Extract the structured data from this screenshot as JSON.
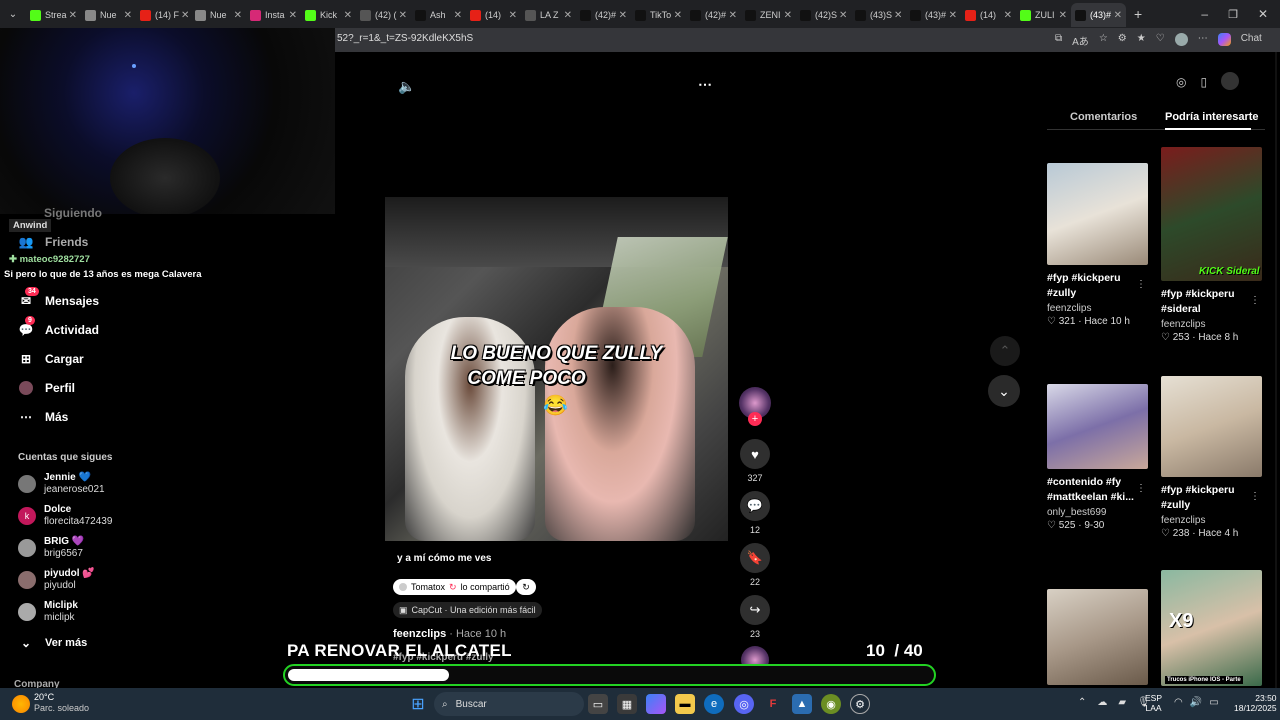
{
  "tabs": [
    {
      "label": "Strea",
      "color": "#53fc18"
    },
    {
      "label": "Nue",
      "color": "#888"
    },
    {
      "label": "(14) F",
      "color": "#e62117"
    },
    {
      "label": "Nue",
      "color": "#888"
    },
    {
      "label": "Insta",
      "color": "#d62976"
    },
    {
      "label": "Kick",
      "color": "#53fc18"
    },
    {
      "label": "(42) (",
      "color": "#555"
    },
    {
      "label": "Ash",
      "color": "#111"
    },
    {
      "label": "(14)",
      "color": "#e62117"
    },
    {
      "label": "LA Z",
      "color": "#555"
    },
    {
      "label": "(42)#",
      "color": "#111"
    },
    {
      "label": "TikTo",
      "color": "#111"
    },
    {
      "label": "(42)#",
      "color": "#111"
    },
    {
      "label": "ZENI",
      "color": "#111"
    },
    {
      "label": "(42)S",
      "color": "#111"
    },
    {
      "label": "(43)S",
      "color": "#111"
    },
    {
      "label": "(43)#",
      "color": "#111"
    },
    {
      "label": "(14)",
      "color": "#e62117"
    },
    {
      "label": "ZULI",
      "color": "#53fc18"
    },
    {
      "label": "(43)#",
      "color": "#111",
      "active": true
    }
  ],
  "url": "52?_r=1&_t=ZS-92KdleKX5hS",
  "browser": {
    "chat_label": "Chat"
  },
  "overlay": {
    "chat_user1": "Anwind",
    "chat_user2": "mateoc9282727",
    "chat_message": "Si pero lo que de 13 años es mega Calavera",
    "faded_nav": "Siguiendo"
  },
  "nav": {
    "friends": "Friends",
    "messages": "Mensajes",
    "messages_badge": "34",
    "activity": "Actividad",
    "activity_badge": "9",
    "upload": "Cargar",
    "profile": "Perfil",
    "more": "Más",
    "following_header": "Cuentas que sigues",
    "see_more": "Ver más",
    "company": "Company"
  },
  "following": [
    {
      "name": "Jennie 💙",
      "handle": "jeanerose021",
      "color": "#777"
    },
    {
      "name": "Dolce",
      "handle": "florecita472439",
      "color": "#c2185b",
      "initial": "k"
    },
    {
      "name": "BRIG 💜",
      "handle": "brig6567",
      "color": "#999"
    },
    {
      "name": "piyudol 💕",
      "handle": "piyudol",
      "color": "#8a6d6d"
    },
    {
      "name": "Miclipk",
      "handle": "miclipk",
      "color": "#aaa"
    }
  ],
  "video": {
    "caption_line1": "LO BUENO QUE ZULLY",
    "caption_line2": "COME POCO",
    "emoji": "😂",
    "description": "y a mí cómo me ves",
    "shared_by": "Tomatox",
    "shared_text": "lo compartió",
    "capcut": "CapCut · Una edición más fácil",
    "author": "feenzclips",
    "time": "· Hace 10 h",
    "tags": "#fyp #kickperu #zully"
  },
  "actions": {
    "likes": "327",
    "comments": "12",
    "saves": "22",
    "shares": "23"
  },
  "panel": {
    "tab_comments": "Comentarios",
    "tab_interesting": "Podría interesarte"
  },
  "cards": [
    {
      "title": "#fyp #kickperu #zully",
      "author": "feenzclips",
      "meta": "♡ 321 · Hace 10 h",
      "bg": "linear-gradient(160deg,#b8c9d6,#e8e2d8 50%,#9a8a78)"
    },
    {
      "title": "#fyp #kickperu #sideral",
      "author": "feenzclips",
      "meta": "♡ 253 · Hace 8 h",
      "bg": "linear-gradient(160deg,#7a1c1c,#2d4a2a 50%,#3a2a1a)"
    },
    {
      "title": "#contenido #fy #mattkeelan #ki...",
      "author": "only_best699",
      "meta": "♡ 525 · 9-30",
      "bg": "linear-gradient(160deg,#d9d9e8,#7c6fa8 50%,#c9a89a)"
    },
    {
      "title": "#fyp #kickperu #zully",
      "author": "feenzclips",
      "meta": "♡ 238 · Hace 4 h",
      "bg": "linear-gradient(160deg,#e6e0d4,#c9b8a2 50%,#8a7a6a)"
    },
    {
      "title": "",
      "author": "",
      "meta": "",
      "bg": "linear-gradient(160deg,#d8d0c4,#a89888 50%,#6a5a4a)"
    },
    {
      "title": "",
      "author": "",
      "meta": "",
      "bg": "linear-gradient(160deg,#8ab8a0,#d8c0a8 50%,#3a6a4a)"
    }
  ],
  "card_overlays": {
    "c2": "KICK Sideral",
    "c6_top": "X9",
    "c6_bottom": "Trucos iPhone IOS - Parte"
  },
  "stream": {
    "title": "PA RENOVAR EL ALCATEL",
    "count": "10",
    "total": "/ 40",
    "progress": 0.25
  },
  "taskbar": {
    "temp": "20°C",
    "weather": "Parc. soleado",
    "search": "Buscar",
    "lang1": "ESP",
    "lang2": "LAA",
    "time": "23:50",
    "date": "18/12/2025"
  }
}
